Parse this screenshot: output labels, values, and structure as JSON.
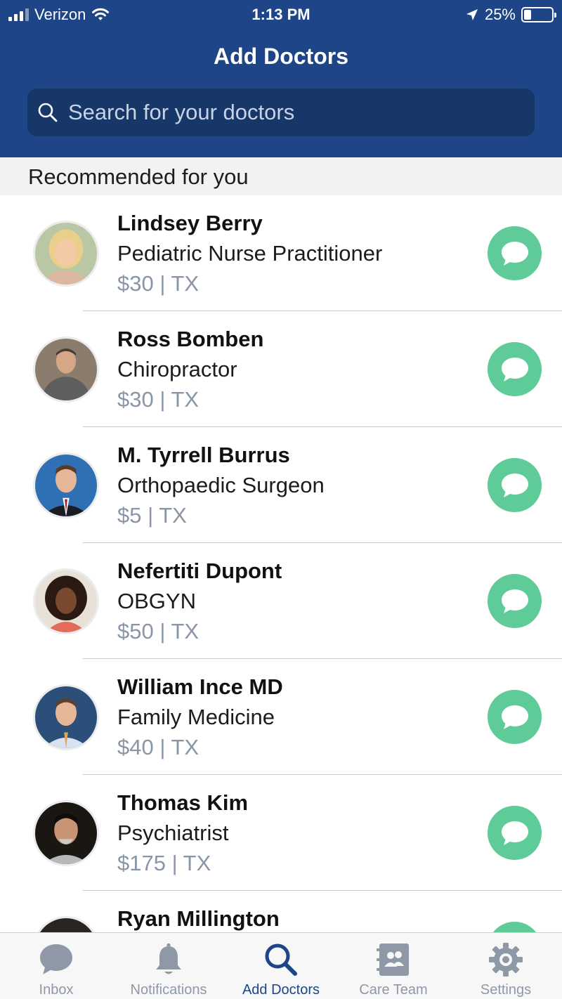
{
  "status_bar": {
    "carrier": "Verizon",
    "time": "1:13 PM",
    "battery": "25%",
    "battery_level": 0.25,
    "icons": [
      "signal-icon",
      "wifi-icon",
      "location-arrow-icon",
      "battery-icon"
    ]
  },
  "header": {
    "title": "Add Doctors",
    "background": "#1d4587"
  },
  "search": {
    "placeholder": "Search for your doctors",
    "value": ""
  },
  "section": {
    "title": "Recommended for you"
  },
  "doctors": [
    {
      "name": "Lindsey Berry",
      "specialty": "Pediatric Nurse Practitioner",
      "price": "$30 | TX"
    },
    {
      "name": "Ross Bomben",
      "specialty": "Chiropractor",
      "price": "$30 | TX"
    },
    {
      "name": "M. Tyrrell Burrus",
      "specialty": "Orthopaedic Surgeon",
      "price": "$5 | TX"
    },
    {
      "name": "Nefertiti Dupont",
      "specialty": "OBGYN",
      "price": "$50 | TX"
    },
    {
      "name": "William Ince MD",
      "specialty": "Family Medicine",
      "price": "$40 | TX"
    },
    {
      "name": "Thomas Kim",
      "specialty": "Psychiatrist",
      "price": "$175 | TX"
    },
    {
      "name": "Ryan Millington",
      "specialty": "",
      "price": ""
    }
  ],
  "colors": {
    "accent": "#1d4587",
    "chat_button": "#5ecb98",
    "price_text": "#8a96a8",
    "tab_inactive": "#8e98a6"
  },
  "tabbar": {
    "active_index": 2,
    "tabs": [
      {
        "label": "Inbox",
        "icon": "chat-bubble-icon"
      },
      {
        "label": "Notifications",
        "icon": "bell-icon"
      },
      {
        "label": "Add Doctors",
        "icon": "search-icon"
      },
      {
        "label": "Care Team",
        "icon": "contacts-book-icon"
      },
      {
        "label": "Settings",
        "icon": "gear-icon"
      }
    ]
  }
}
